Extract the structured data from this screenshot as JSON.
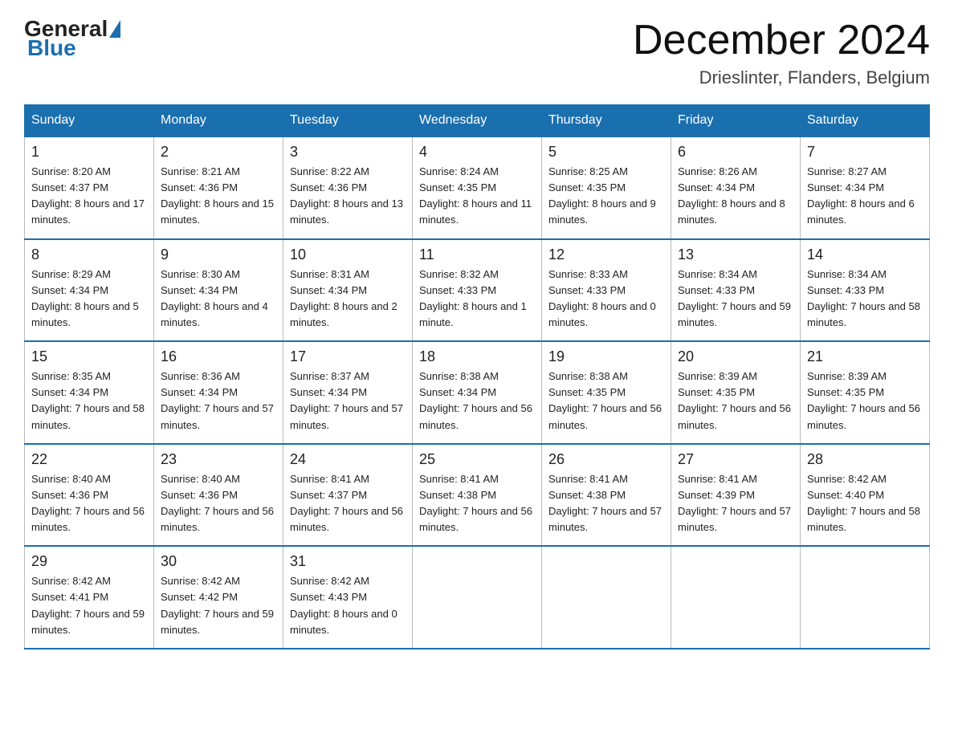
{
  "header": {
    "logo_general": "General",
    "logo_blue": "Blue",
    "month_title": "December 2024",
    "location": "Drieslinter, Flanders, Belgium"
  },
  "days_of_week": [
    "Sunday",
    "Monday",
    "Tuesday",
    "Wednesday",
    "Thursday",
    "Friday",
    "Saturday"
  ],
  "weeks": [
    [
      {
        "day": "1",
        "sunrise": "8:20 AM",
        "sunset": "4:37 PM",
        "daylight": "8 hours and 17 minutes."
      },
      {
        "day": "2",
        "sunrise": "8:21 AM",
        "sunset": "4:36 PM",
        "daylight": "8 hours and 15 minutes."
      },
      {
        "day": "3",
        "sunrise": "8:22 AM",
        "sunset": "4:36 PM",
        "daylight": "8 hours and 13 minutes."
      },
      {
        "day": "4",
        "sunrise": "8:24 AM",
        "sunset": "4:35 PM",
        "daylight": "8 hours and 11 minutes."
      },
      {
        "day": "5",
        "sunrise": "8:25 AM",
        "sunset": "4:35 PM",
        "daylight": "8 hours and 9 minutes."
      },
      {
        "day": "6",
        "sunrise": "8:26 AM",
        "sunset": "4:34 PM",
        "daylight": "8 hours and 8 minutes."
      },
      {
        "day": "7",
        "sunrise": "8:27 AM",
        "sunset": "4:34 PM",
        "daylight": "8 hours and 6 minutes."
      }
    ],
    [
      {
        "day": "8",
        "sunrise": "8:29 AM",
        "sunset": "4:34 PM",
        "daylight": "8 hours and 5 minutes."
      },
      {
        "day": "9",
        "sunrise": "8:30 AM",
        "sunset": "4:34 PM",
        "daylight": "8 hours and 4 minutes."
      },
      {
        "day": "10",
        "sunrise": "8:31 AM",
        "sunset": "4:34 PM",
        "daylight": "8 hours and 2 minutes."
      },
      {
        "day": "11",
        "sunrise": "8:32 AM",
        "sunset": "4:33 PM",
        "daylight": "8 hours and 1 minute."
      },
      {
        "day": "12",
        "sunrise": "8:33 AM",
        "sunset": "4:33 PM",
        "daylight": "8 hours and 0 minutes."
      },
      {
        "day": "13",
        "sunrise": "8:34 AM",
        "sunset": "4:33 PM",
        "daylight": "7 hours and 59 minutes."
      },
      {
        "day": "14",
        "sunrise": "8:34 AM",
        "sunset": "4:33 PM",
        "daylight": "7 hours and 58 minutes."
      }
    ],
    [
      {
        "day": "15",
        "sunrise": "8:35 AM",
        "sunset": "4:34 PM",
        "daylight": "7 hours and 58 minutes."
      },
      {
        "day": "16",
        "sunrise": "8:36 AM",
        "sunset": "4:34 PM",
        "daylight": "7 hours and 57 minutes."
      },
      {
        "day": "17",
        "sunrise": "8:37 AM",
        "sunset": "4:34 PM",
        "daylight": "7 hours and 57 minutes."
      },
      {
        "day": "18",
        "sunrise": "8:38 AM",
        "sunset": "4:34 PM",
        "daylight": "7 hours and 56 minutes."
      },
      {
        "day": "19",
        "sunrise": "8:38 AM",
        "sunset": "4:35 PM",
        "daylight": "7 hours and 56 minutes."
      },
      {
        "day": "20",
        "sunrise": "8:39 AM",
        "sunset": "4:35 PM",
        "daylight": "7 hours and 56 minutes."
      },
      {
        "day": "21",
        "sunrise": "8:39 AM",
        "sunset": "4:35 PM",
        "daylight": "7 hours and 56 minutes."
      }
    ],
    [
      {
        "day": "22",
        "sunrise": "8:40 AM",
        "sunset": "4:36 PM",
        "daylight": "7 hours and 56 minutes."
      },
      {
        "day": "23",
        "sunrise": "8:40 AM",
        "sunset": "4:36 PM",
        "daylight": "7 hours and 56 minutes."
      },
      {
        "day": "24",
        "sunrise": "8:41 AM",
        "sunset": "4:37 PM",
        "daylight": "7 hours and 56 minutes."
      },
      {
        "day": "25",
        "sunrise": "8:41 AM",
        "sunset": "4:38 PM",
        "daylight": "7 hours and 56 minutes."
      },
      {
        "day": "26",
        "sunrise": "8:41 AM",
        "sunset": "4:38 PM",
        "daylight": "7 hours and 57 minutes."
      },
      {
        "day": "27",
        "sunrise": "8:41 AM",
        "sunset": "4:39 PM",
        "daylight": "7 hours and 57 minutes."
      },
      {
        "day": "28",
        "sunrise": "8:42 AM",
        "sunset": "4:40 PM",
        "daylight": "7 hours and 58 minutes."
      }
    ],
    [
      {
        "day": "29",
        "sunrise": "8:42 AM",
        "sunset": "4:41 PM",
        "daylight": "7 hours and 59 minutes."
      },
      {
        "day": "30",
        "sunrise": "8:42 AM",
        "sunset": "4:42 PM",
        "daylight": "7 hours and 59 minutes."
      },
      {
        "day": "31",
        "sunrise": "8:42 AM",
        "sunset": "4:43 PM",
        "daylight": "8 hours and 0 minutes."
      },
      null,
      null,
      null,
      null
    ]
  ]
}
